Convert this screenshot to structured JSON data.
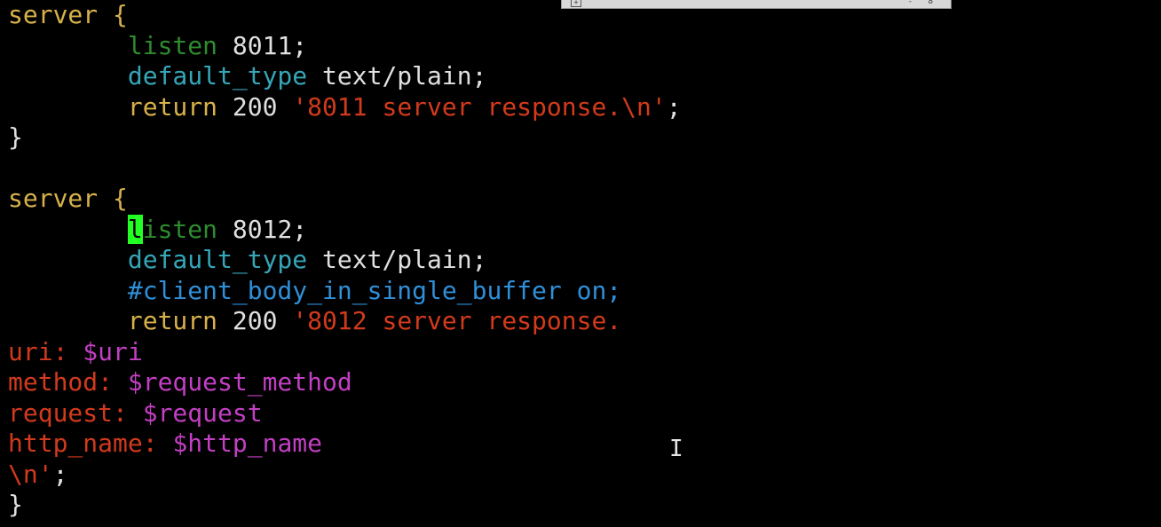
{
  "window": {
    "titlebar_left_glyph": "+",
    "titlebar_right_glyphs": "- 8"
  },
  "editor": {
    "lines": [
      [
        {
          "t": "server {",
          "c": "kw-server"
        }
      ],
      [
        {
          "t": "        ",
          "c": "plain"
        },
        {
          "t": "listen",
          "c": "kw-listen"
        },
        {
          "t": " 8011;",
          "c": "num"
        }
      ],
      [
        {
          "t": "        ",
          "c": "plain"
        },
        {
          "t": "default_type",
          "c": "kw-default"
        },
        {
          "t": " text/plain;",
          "c": "plain"
        }
      ],
      [
        {
          "t": "        ",
          "c": "plain"
        },
        {
          "t": "return",
          "c": "kw-return"
        },
        {
          "t": " 200 ",
          "c": "num"
        },
        {
          "t": "'8011 server response.\\n'",
          "c": "str"
        },
        {
          "t": ";",
          "c": "plain"
        }
      ],
      [
        {
          "t": "}",
          "c": "plain"
        }
      ],
      [
        {
          "t": "",
          "c": "plain"
        }
      ],
      [
        {
          "t": "server {",
          "c": "kw-server"
        }
      ],
      [
        {
          "t": "        ",
          "c": "plain"
        },
        {
          "t": "l",
          "c": "cursor-block"
        },
        {
          "t": "isten",
          "c": "kw-listen"
        },
        {
          "t": " 8012;",
          "c": "num"
        }
      ],
      [
        {
          "t": "        ",
          "c": "plain"
        },
        {
          "t": "default_type",
          "c": "kw-default"
        },
        {
          "t": " text/plain;",
          "c": "plain"
        }
      ],
      [
        {
          "t": "        ",
          "c": "plain"
        },
        {
          "t": "#client_body_in_single_buffer on;",
          "c": "comment"
        }
      ],
      [
        {
          "t": "        ",
          "c": "plain"
        },
        {
          "t": "return",
          "c": "kw-return"
        },
        {
          "t": " 200 ",
          "c": "num"
        },
        {
          "t": "'8012 server response.",
          "c": "str"
        }
      ],
      [
        {
          "t": "uri: ",
          "c": "str"
        },
        {
          "t": "$uri",
          "c": "var"
        }
      ],
      [
        {
          "t": "method: ",
          "c": "str"
        },
        {
          "t": "$request_method",
          "c": "var"
        }
      ],
      [
        {
          "t": "request: ",
          "c": "str"
        },
        {
          "t": "$request",
          "c": "var"
        }
      ],
      [
        {
          "t": "http_name: ",
          "c": "str"
        },
        {
          "t": "$http_name",
          "c": "var"
        }
      ],
      [
        {
          "t": "\\n'",
          "c": "str"
        },
        {
          "t": ";",
          "c": "plain"
        }
      ],
      [
        {
          "t": "}",
          "c": "plain"
        }
      ]
    ]
  },
  "mouse_cursor": {
    "icon": "text-ibeam-cursor-icon",
    "glyph": "I"
  },
  "colors": {
    "background": "#000000",
    "server_keyword": "#d7b24a",
    "listen_keyword": "#2e8b2e",
    "default_type_keyword": "#35a6b8",
    "string": "#d23a1c",
    "comment": "#2f8fd8",
    "variable": "#c33fc3",
    "cursor": "#22ff22"
  }
}
